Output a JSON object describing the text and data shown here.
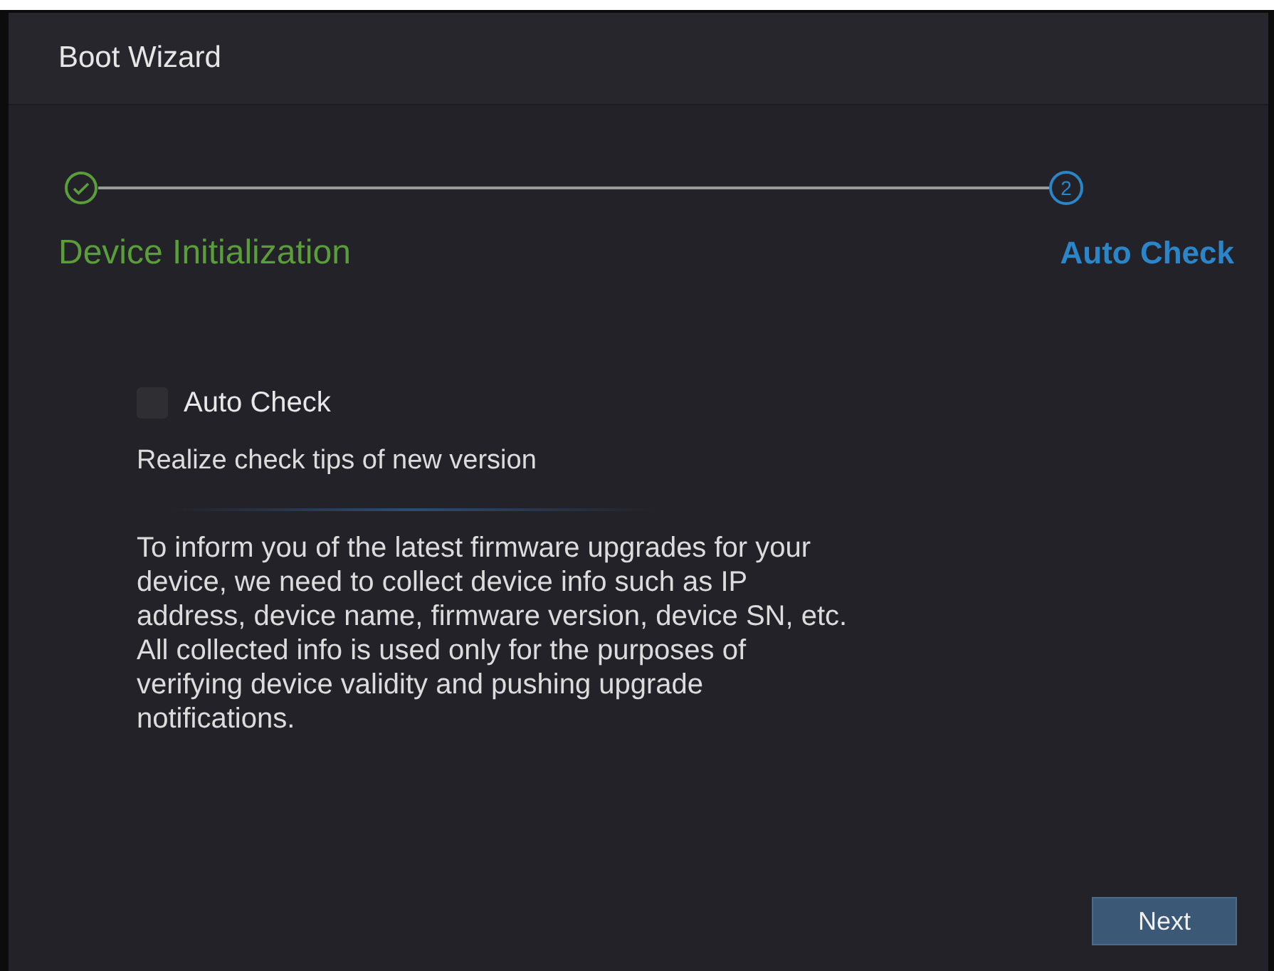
{
  "window": {
    "title": "Boot Wizard"
  },
  "steps": [
    {
      "label": "Device Initialization",
      "completed": true,
      "current": false
    },
    {
      "label": "Auto Check",
      "number": "2",
      "completed": false,
      "current": true
    }
  ],
  "auto_check": {
    "label": "Auto Check",
    "checked": false
  },
  "tip": "Realize check tips of new version",
  "description": "To inform you of the latest firmware upgrades for your device, we need to collect device info such as IP address, device name, firmware version, device SN, etc. All collected info is used only for the purposes of verifying device validity and pushing upgrade notifications.",
  "buttons": [
    {
      "label": "Next"
    }
  ]
}
